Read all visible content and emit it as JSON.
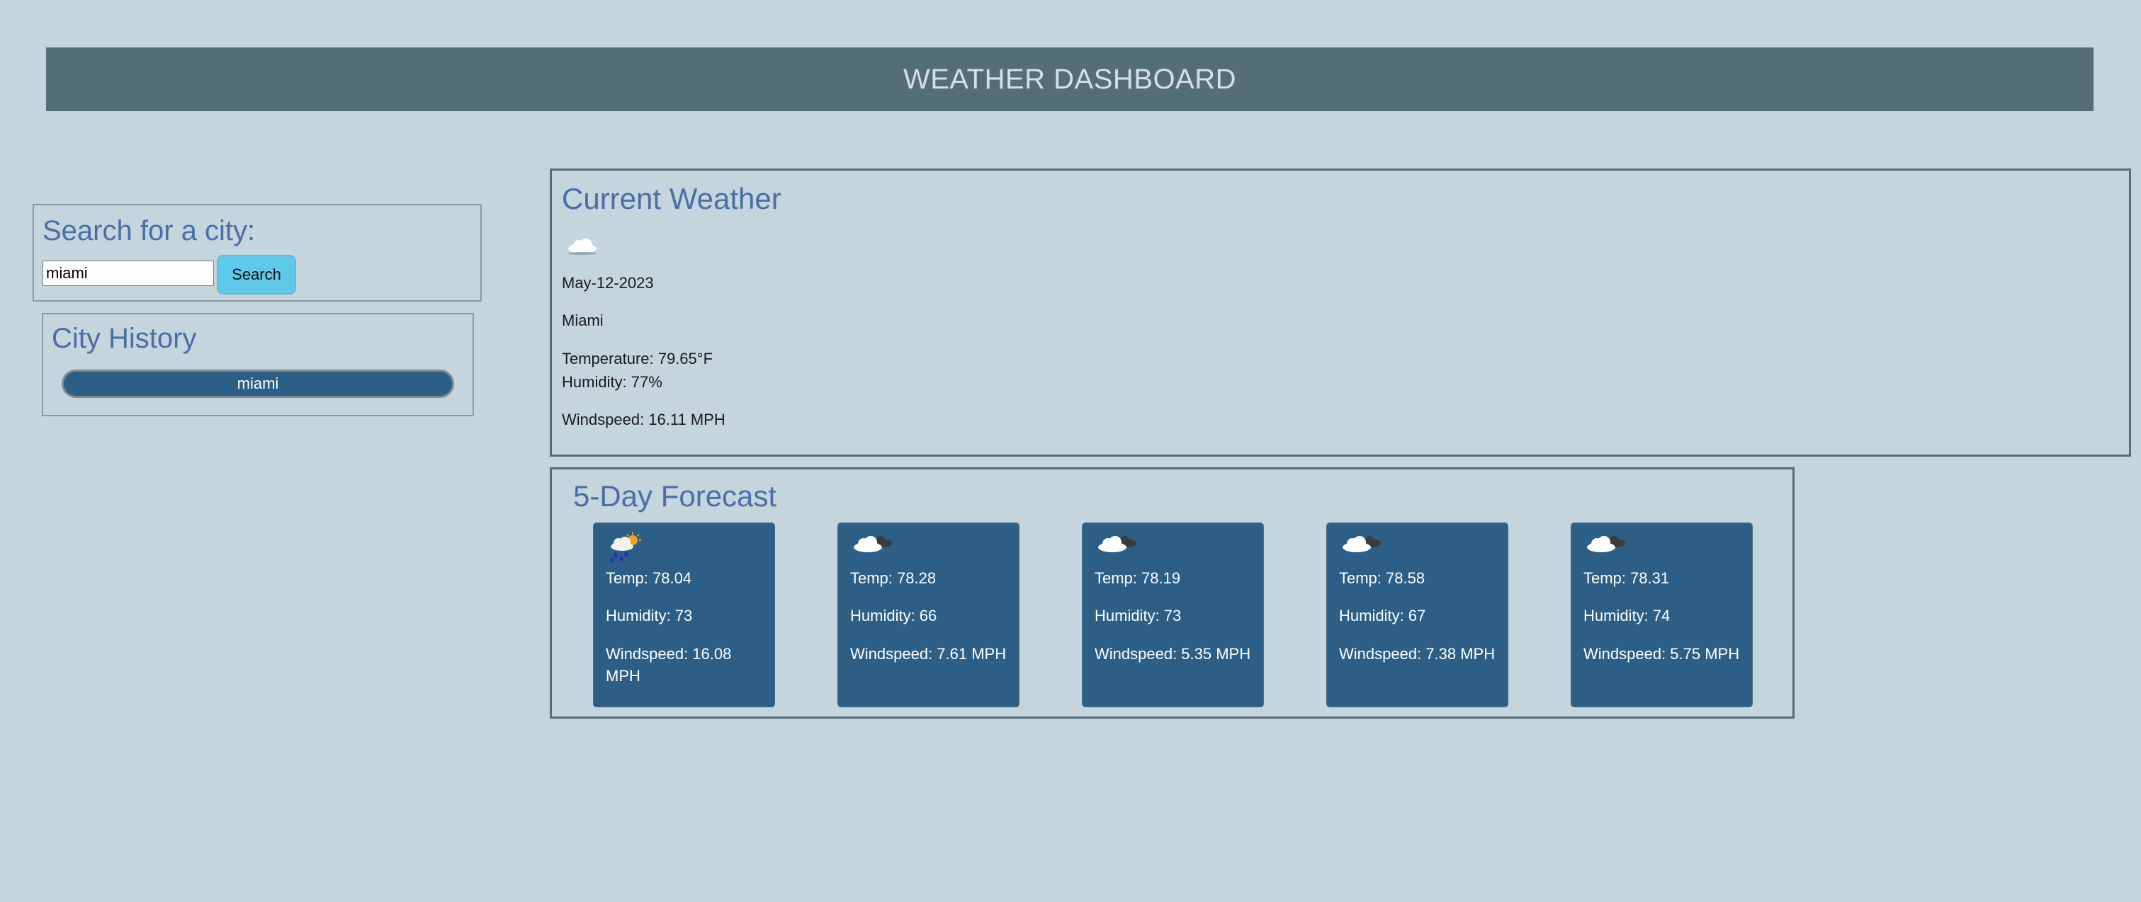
{
  "header": {
    "title": "WEATHER DASHBOARD"
  },
  "search": {
    "heading": "Search for a city:",
    "input_value": "miami",
    "button_label": "Search"
  },
  "history": {
    "heading": "City History",
    "items": [
      "miami"
    ]
  },
  "current": {
    "heading": "Current Weather",
    "icon": "cloud-icon",
    "date": "May-12-2023",
    "city": "Miami",
    "temperature": "Temperature: 79.65°F",
    "humidity": "Humidity: 77%",
    "windspeed": "Windspeed: 16.11 MPH"
  },
  "forecast": {
    "heading": "5-Day Forecast",
    "days": [
      {
        "icon": "rain-sun-icon",
        "temp": "Temp: 78.04",
        "humidity": "Humidity: 73",
        "windspeed": "Windspeed: 16.08 MPH"
      },
      {
        "icon": "cloud-night-icon",
        "temp": "Temp: 78.28",
        "humidity": "Humidity: 66",
        "windspeed": "Windspeed: 7.61 MPH"
      },
      {
        "icon": "cloud-night-icon",
        "temp": "Temp: 78.19",
        "humidity": "Humidity: 73",
        "windspeed": "Windspeed: 5.35 MPH"
      },
      {
        "icon": "cloud-night-icon",
        "temp": "Temp: 78.58",
        "humidity": "Humidity: 67",
        "windspeed": "Windspeed: 7.38 MPH"
      },
      {
        "icon": "cloud-night-icon",
        "temp": "Temp: 78.31",
        "humidity": "Humidity: 74",
        "windspeed": "Windspeed: 5.75 MPH"
      }
    ]
  },
  "colors": {
    "background": "#c4d5dd",
    "header": "#546d7a",
    "heading_text": "#4a6ea6",
    "card": "#2d5f86",
    "search_button": "#5ec9ea"
  }
}
